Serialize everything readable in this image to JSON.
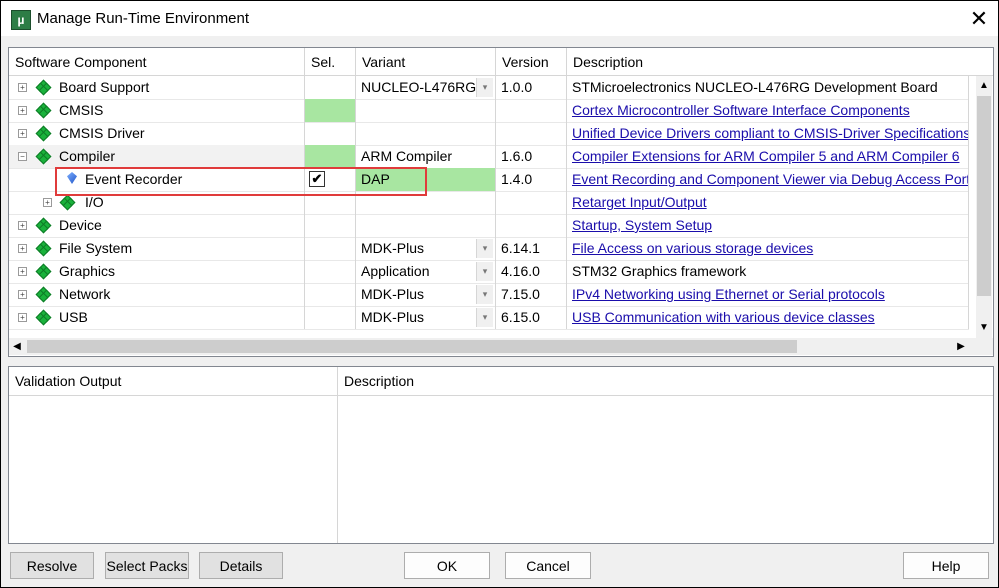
{
  "window": {
    "title": "Manage Run-Time Environment",
    "app_icon": "µ",
    "close_glyph": "✕"
  },
  "grid": {
    "headers": {
      "component": "Software Component",
      "sel": "Sel.",
      "variant": "Variant",
      "version": "Version",
      "description": "Description"
    },
    "rows": [
      {
        "name": "Board Support",
        "variant": "NUCLEO-L476RG",
        "version": "1.0.0",
        "description": "STMicroelectronics NUCLEO-L476RG Development Board"
      },
      {
        "name": "CMSIS",
        "variant": "",
        "version": "",
        "description": "Cortex Microcontroller Software Interface Components"
      },
      {
        "name": "CMSIS Driver",
        "variant": "",
        "version": "",
        "description": "Unified Device Drivers compliant to CMSIS-Driver Specifications"
      },
      {
        "name": "Compiler",
        "variant": "ARM Compiler",
        "version": "1.6.0",
        "description": "Compiler Extensions for ARM Compiler 5 and ARM Compiler 6"
      },
      {
        "name": "Event Recorder",
        "variant": "DAP",
        "version": "1.4.0",
        "description": "Event Recording and Component Viewer via Debug Access Port (D",
        "checked": "✔"
      },
      {
        "name": "I/O",
        "variant": "",
        "version": "",
        "description": "Retarget Input/Output"
      },
      {
        "name": "Device",
        "variant": "",
        "version": "",
        "description": "Startup, System Setup"
      },
      {
        "name": "File System",
        "variant": "MDK-Plus",
        "version": "6.14.1",
        "description": "File Access on various storage devices"
      },
      {
        "name": "Graphics",
        "variant": "Application",
        "version": "4.16.0",
        "description": "STM32 Graphics framework"
      },
      {
        "name": "Network",
        "variant": "MDK-Plus",
        "version": "7.15.0",
        "description": "IPv4 Networking using Ethernet or Serial protocols"
      },
      {
        "name": "USB",
        "variant": "MDK-Plus",
        "version": "6.15.0",
        "description": "USB Communication with various device classes"
      }
    ]
  },
  "validation": {
    "header_output": "Validation Output",
    "header_description": "Description"
  },
  "buttons": {
    "resolve": "Resolve",
    "select_packs": "Select Packs",
    "details": "Details",
    "ok": "OK",
    "cancel": "Cancel",
    "help": "Help"
  },
  "colors": {
    "selected_green": "#a8e6a1",
    "highlight_red": "#e03b3b",
    "link_blue": "#1a0dab"
  }
}
